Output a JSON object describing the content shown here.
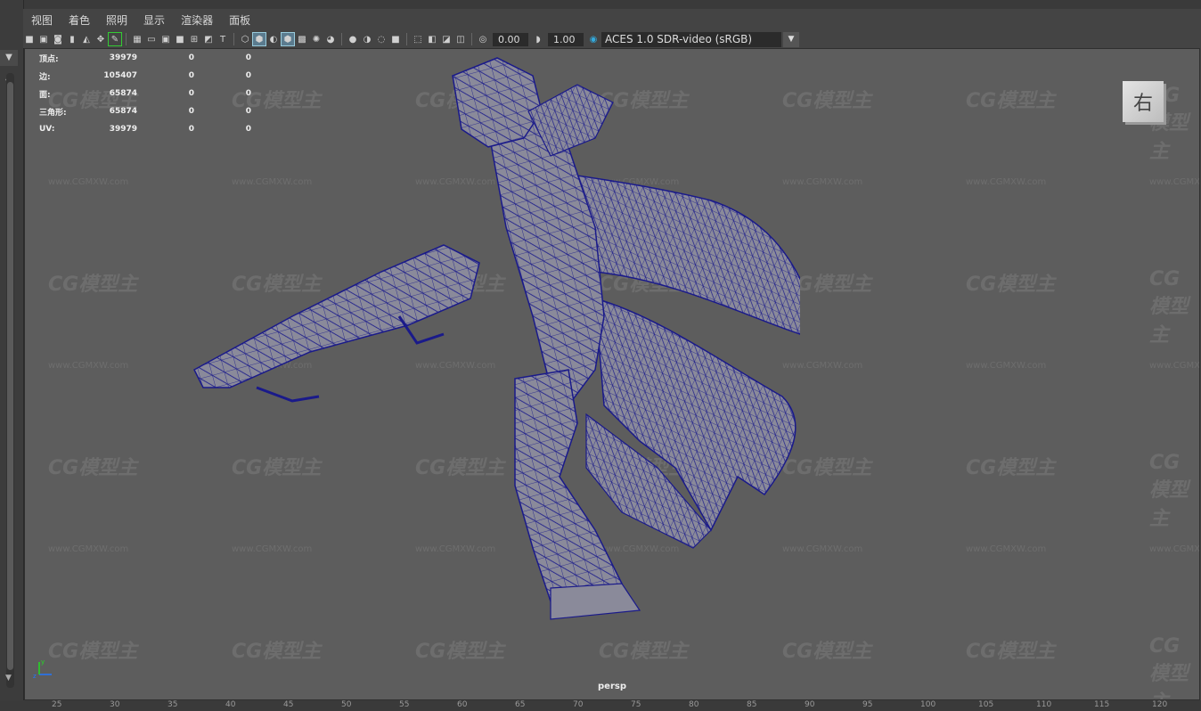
{
  "menu": [
    "视图",
    "着色",
    "照明",
    "显示",
    "渲染器",
    "面板"
  ],
  "toolbar": {
    "exposure_value": "0.00",
    "gamma_value": "1.00",
    "color_space": "ACES 1.0 SDR-video (sRGB)"
  },
  "hud": {
    "rows": [
      {
        "label": "顶点:",
        "v1": "39979",
        "v2": "0",
        "v3": "0"
      },
      {
        "label": "边:",
        "v1": "105407",
        "v2": "0",
        "v3": "0"
      },
      {
        "label": "面:",
        "v1": "65874",
        "v2": "0",
        "v3": "0"
      },
      {
        "label": "三角形:",
        "v1": "65874",
        "v2": "0",
        "v3": "0"
      },
      {
        "label": "UV:",
        "v1": "39979",
        "v2": "0",
        "v3": "0"
      }
    ]
  },
  "viewport": {
    "view_cube_label": "右",
    "camera": "persp"
  },
  "watermark": {
    "brand": "CG模型主",
    "url": "www.CGMXW.com"
  },
  "ruler_ticks": [
    "25",
    "30",
    "35",
    "40",
    "45",
    "50",
    "55",
    "60",
    "65",
    "70",
    "75",
    "80",
    "85",
    "90",
    "95",
    "100",
    "105",
    "110",
    "115",
    "120"
  ],
  "colors": {
    "wireframe": "#1a1a8a",
    "viewport_bg": "#5d5d5d"
  }
}
